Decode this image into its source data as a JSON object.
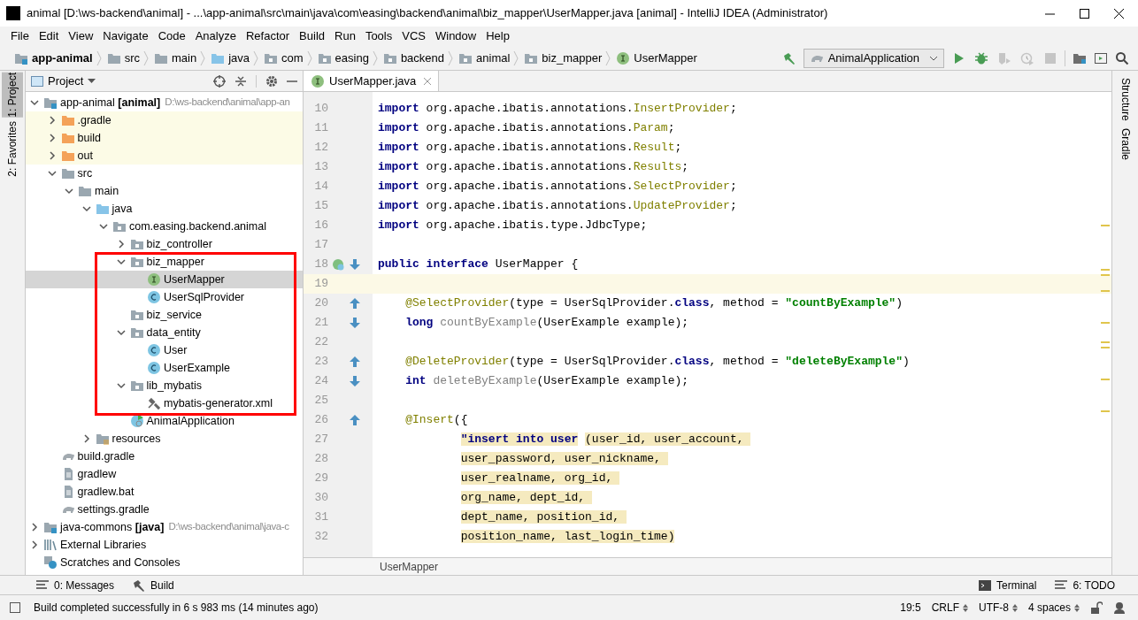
{
  "window": {
    "title": "animal [D:\\ws-backend\\animal] - ...\\app-animal\\src\\main\\java\\com\\easing\\backend\\animal\\biz_mapper\\UserMapper.java [animal] - IntelliJ IDEA (Administrator)"
  },
  "menu": [
    "File",
    "Edit",
    "View",
    "Navigate",
    "Code",
    "Analyze",
    "Refactor",
    "Build",
    "Run",
    "Tools",
    "VCS",
    "Window",
    "Help"
  ],
  "breadcrumbs": [
    {
      "label": "app-animal",
      "kind": "module"
    },
    {
      "label": "src",
      "kind": "folder"
    },
    {
      "label": "main",
      "kind": "folder"
    },
    {
      "label": "java",
      "kind": "src"
    },
    {
      "label": "com",
      "kind": "package"
    },
    {
      "label": "easing",
      "kind": "package"
    },
    {
      "label": "backend",
      "kind": "package"
    },
    {
      "label": "animal",
      "kind": "package"
    },
    {
      "label": "biz_mapper",
      "kind": "package"
    },
    {
      "label": "UserMapper",
      "kind": "interface"
    }
  ],
  "run_config": "AnimalApplication",
  "toolbar": [
    {
      "kind": "run",
      "disabled": false
    },
    {
      "kind": "debug",
      "disabled": false
    },
    {
      "kind": "coverage",
      "disabled": true
    },
    {
      "kind": "profile",
      "disabled": true
    },
    {
      "kind": "stop",
      "disabled": true
    }
  ],
  "left_tool_tabs": [
    {
      "label": "1: Project",
      "selected": true
    },
    {
      "label": "2: Favorites",
      "selected": false
    }
  ],
  "right_tool_tabs": [
    {
      "label": "Structure"
    },
    {
      "label": "Gradle"
    }
  ],
  "project_panel": {
    "title": "Project",
    "tree": [
      {
        "label": "app-animal **[animal]**",
        "path": "D:\\ws-backend\\animal\\app-an",
        "kind": "module",
        "expanded": true,
        "excluded": false,
        "selected": false,
        "children": [
          {
            "label": ".gradle",
            "kind": "excluded",
            "expanded": false,
            "excluded": true,
            "selected": false
          },
          {
            "label": "build",
            "kind": "excluded",
            "expanded": false,
            "excluded": true,
            "selected": false
          },
          {
            "label": "out",
            "kind": "excluded",
            "expanded": false,
            "excluded": true,
            "selected": false
          },
          {
            "label": "src",
            "kind": "folder",
            "expanded": true,
            "excluded": false,
            "selected": false,
            "children": [
              {
                "label": "main",
                "kind": "folder",
                "expanded": true,
                "excluded": false,
                "selected": false,
                "children": [
                  {
                    "label": "java",
                    "kind": "src",
                    "expanded": true,
                    "excluded": false,
                    "selected": false,
                    "children": [
                      {
                        "label": "com.easing.backend.animal",
                        "kind": "package",
                        "expanded": true,
                        "excluded": false,
                        "selected": false,
                        "children": [
                          {
                            "label": "biz_controller",
                            "kind": "package",
                            "expanded": false,
                            "excluded": false,
                            "selected": false
                          },
                          {
                            "label": "biz_mapper",
                            "kind": "package",
                            "expanded": true,
                            "excluded": false,
                            "selected": false,
                            "children": [
                              {
                                "label": "UserMapper",
                                "kind": "interface",
                                "excluded": false,
                                "selected": true
                              },
                              {
                                "label": "UserSqlProvider",
                                "kind": "class",
                                "excluded": false,
                                "selected": false
                              }
                            ]
                          },
                          {
                            "label": "biz_service",
                            "kind": "package",
                            "excluded": false,
                            "selected": false
                          },
                          {
                            "label": "data_entity",
                            "kind": "package",
                            "expanded": true,
                            "excluded": false,
                            "selected": false,
                            "children": [
                              {
                                "label": "User",
                                "kind": "class",
                                "excluded": false,
                                "selected": false
                              },
                              {
                                "label": "UserExample",
                                "kind": "class",
                                "excluded": false,
                                "selected": false
                              }
                            ]
                          },
                          {
                            "label": "lib_mybatis",
                            "kind": "package",
                            "expanded": true,
                            "excluded": false,
                            "selected": false,
                            "children": [
                              {
                                "label": "mybatis-generator.xml",
                                "kind": "tools",
                                "excluded": false,
                                "selected": false
                              }
                            ]
                          },
                          {
                            "label": "AnimalApplication",
                            "kind": "app",
                            "excluded": false,
                            "selected": false
                          }
                        ]
                      }
                    ]
                  },
                  {
                    "label": "resources",
                    "kind": "resources",
                    "expanded": false,
                    "excluded": false,
                    "selected": false
                  }
                ]
              }
            ]
          },
          {
            "label": "build.gradle",
            "kind": "gradle",
            "excluded": false,
            "selected": false
          },
          {
            "label": "gradlew",
            "kind": "file",
            "excluded": false,
            "selected": false
          },
          {
            "label": "gradlew.bat",
            "kind": "file",
            "excluded": false,
            "selected": false
          },
          {
            "label": "settings.gradle",
            "kind": "gradle",
            "excluded": false,
            "selected": false
          }
        ]
      },
      {
        "label": "java-commons **[java]**",
        "path": "D:\\ws-backend\\animal\\java-c",
        "kind": "module",
        "expanded": false,
        "excluded": false,
        "selected": false
      },
      {
        "label": "External Libraries",
        "kind": "libraries",
        "expanded": false,
        "excluded": false,
        "selected": false
      },
      {
        "label": "Scratches and Consoles",
        "kind": "scratches",
        "excluded": false,
        "selected": false
      }
    ]
  },
  "editor": {
    "tabs": [
      {
        "label": "UserMapper.java",
        "kind": "interface",
        "selected": true
      }
    ],
    "lines": [
      {
        "n": "10",
        "tokens": [
          {
            "kind": "kw",
            "text": "import"
          },
          {
            "kind": "p",
            "text": " org.apache.ibatis.annotations."
          },
          {
            "kind": "ann",
            "text": "InsertProvider"
          },
          {
            "kind": "p",
            "text": ";"
          }
        ]
      },
      {
        "n": "11",
        "tokens": [
          {
            "kind": "kw",
            "text": "import"
          },
          {
            "kind": "p",
            "text": " org.apache.ibatis.annotations."
          },
          {
            "kind": "ann",
            "text": "Param"
          },
          {
            "kind": "p",
            "text": ";"
          }
        ]
      },
      {
        "n": "12",
        "tokens": [
          {
            "kind": "kw",
            "text": "import"
          },
          {
            "kind": "p",
            "text": " org.apache.ibatis.annotations."
          },
          {
            "kind": "ann",
            "text": "Result"
          },
          {
            "kind": "p",
            "text": ";"
          }
        ]
      },
      {
        "n": "13",
        "tokens": [
          {
            "kind": "kw",
            "text": "import"
          },
          {
            "kind": "p",
            "text": " org.apache.ibatis.annotations."
          },
          {
            "kind": "ann",
            "text": "Results"
          },
          {
            "kind": "p",
            "text": ";"
          }
        ]
      },
      {
        "n": "14",
        "tokens": [
          {
            "kind": "kw",
            "text": "import"
          },
          {
            "kind": "p",
            "text": " org.apache.ibatis.annotations."
          },
          {
            "kind": "ann",
            "text": "SelectProvider"
          },
          {
            "kind": "p",
            "text": ";"
          }
        ]
      },
      {
        "n": "15",
        "tokens": [
          {
            "kind": "kw",
            "text": "import"
          },
          {
            "kind": "p",
            "text": " org.apache.ibatis.annotations."
          },
          {
            "kind": "ann",
            "text": "UpdateProvider"
          },
          {
            "kind": "p",
            "text": ";"
          }
        ]
      },
      {
        "n": "16",
        "tokens": [
          {
            "kind": "kw",
            "text": "import"
          },
          {
            "kind": "p",
            "text": " org.apache.ibatis.type.JdbcType;"
          }
        ]
      },
      {
        "n": "17",
        "current": false
      },
      {
        "n": "18",
        "gutter": [
          {
            "kind": "impl"
          },
          {
            "kind": "down"
          }
        ],
        "tokens": [
          {
            "kind": "kw",
            "text": "public interface"
          },
          {
            "kind": "p",
            "text": " UserMapper {"
          }
        ]
      },
      {
        "n": "19",
        "current": true
      },
      {
        "n": "20",
        "gutter": [
          {
            "kind": "up"
          }
        ],
        "tokens": [
          {
            "kind": "ann",
            "text": "    @SelectProvider"
          },
          {
            "kind": "p",
            "text": "(type = UserSqlProvider."
          },
          {
            "kind": "kw",
            "text": "class"
          },
          {
            "kind": "p",
            "text": ", method = "
          },
          {
            "kind": "str",
            "text": "\"countByExample\""
          },
          {
            "kind": "p",
            "text": ")"
          }
        ]
      },
      {
        "n": "21",
        "gutter": [
          {
            "kind": "down"
          }
        ],
        "tokens": [
          {
            "kind": "kw",
            "text": "    long"
          },
          {
            "kind": "unused",
            "text": " countByExample"
          },
          {
            "kind": "p",
            "text": "(UserExample example);"
          }
        ]
      },
      {
        "n": "22"
      },
      {
        "n": "23",
        "gutter": [
          {
            "kind": "up"
          }
        ],
        "tokens": [
          {
            "kind": "ann",
            "text": "    @DeleteProvider"
          },
          {
            "kind": "p",
            "text": "(type = UserSqlProvider."
          },
          {
            "kind": "kw",
            "text": "class"
          },
          {
            "kind": "p",
            "text": ", method = "
          },
          {
            "kind": "str",
            "text": "\"deleteByExample\""
          },
          {
            "kind": "p",
            "text": ")"
          }
        ]
      },
      {
        "n": "24",
        "gutter": [
          {
            "kind": "down"
          }
        ],
        "tokens": [
          {
            "kind": "kw",
            "text": "    int"
          },
          {
            "kind": "unused",
            "text": " deleteByExample"
          },
          {
            "kind": "p",
            "text": "(UserExample example);"
          }
        ]
      },
      {
        "n": "25"
      },
      {
        "n": "26",
        "gutter": [
          {
            "kind": "up"
          }
        ],
        "tokens": [
          {
            "kind": "ann",
            "text": "    @Insert"
          },
          {
            "kind": "p",
            "text": "({"
          }
        ]
      },
      {
        "n": "27",
        "tokens": [
          {
            "kind": "sqk",
            "text": "            \"insert into user"
          },
          {
            "kind": "sq",
            "text": " (user_id, user_account, "
          }
        ]
      },
      {
        "n": "28",
        "tokens": [
          {
            "kind": "sq",
            "text": "            user_password, user_nickname, "
          }
        ]
      },
      {
        "n": "29",
        "tokens": [
          {
            "kind": "sq",
            "text": "            user_realname, org_id, "
          }
        ]
      },
      {
        "n": "30",
        "tokens": [
          {
            "kind": "sq",
            "text": "            org_name, dept_id, "
          }
        ]
      },
      {
        "n": "31",
        "tokens": [
          {
            "kind": "sq",
            "text": "            dept_name, position_id, "
          }
        ]
      },
      {
        "n": "32",
        "tokens": [
          {
            "kind": "sq",
            "text": "            position_name, last_login_time)"
          }
        ]
      }
    ],
    "breadcrumb": "UserMapper"
  },
  "tool_buttons": {
    "left": [
      {
        "label": "0: Messages",
        "kind": "messages"
      },
      {
        "label": "Build",
        "kind": "hammer"
      }
    ],
    "right": [
      {
        "label": "Terminal",
        "kind": "terminal"
      },
      {
        "label": "6: TODO",
        "kind": "messages"
      }
    ]
  },
  "status_bar": {
    "message": "Build completed successfully in 6 s 983 ms (14 minutes ago)",
    "position": "19:5",
    "line_separator": "CRLF",
    "encoding": "UTF-8",
    "indent": "4 spaces"
  }
}
